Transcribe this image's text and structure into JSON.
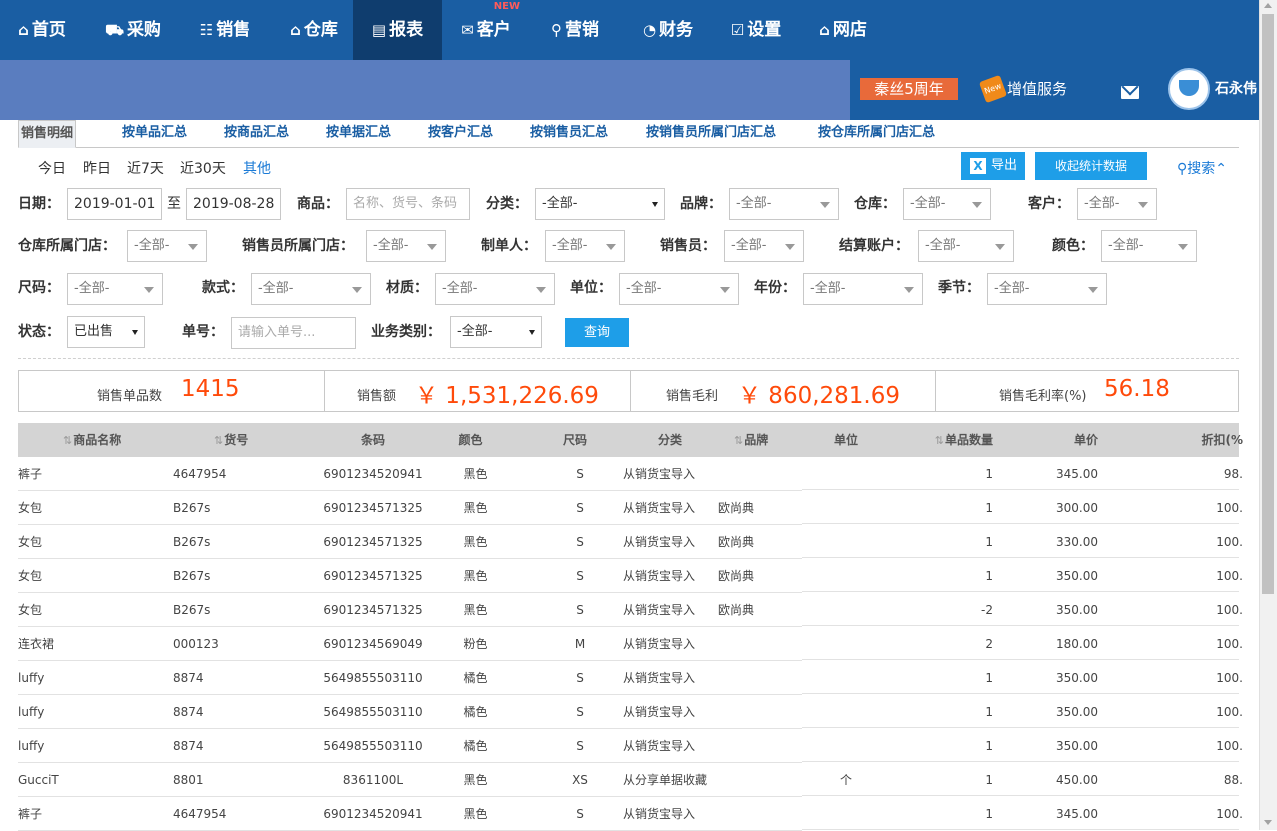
{
  "nav": {
    "items": [
      {
        "label": "首页",
        "icon": "home-icon",
        "glyph": "⌂"
      },
      {
        "label": "采购",
        "icon": "basket-icon",
        "glyph": "⛟"
      },
      {
        "label": "销售",
        "icon": "people-icon",
        "glyph": "☷"
      },
      {
        "label": "仓库",
        "icon": "warehouse-icon",
        "glyph": "⌂"
      },
      {
        "label": "报表",
        "icon": "report-icon",
        "glyph": "▤"
      },
      {
        "label": "客户",
        "icon": "mail-icon",
        "glyph": "✉"
      },
      {
        "label": "营销",
        "icon": "tag-icon",
        "glyph": "⚲"
      },
      {
        "label": "财务",
        "icon": "finance-icon",
        "glyph": "◔"
      },
      {
        "label": "设置",
        "icon": "settings-icon",
        "glyph": "☑"
      },
      {
        "label": "网店",
        "icon": "shop-icon",
        "glyph": "⌂"
      }
    ],
    "active_label": "报表",
    "new_badge": "NEW"
  },
  "banner": {
    "anniversary": "秦丝5周年",
    "value_added_service": "增值服务",
    "value_added_badge": "New",
    "username": "石永伟"
  },
  "tabs": [
    "销售明细",
    "按单品汇总",
    "按商品汇总",
    "按单据汇总",
    "按客户汇总",
    "按销售员汇总",
    "按销售员所属门店汇总",
    "按仓库所属门店汇总"
  ],
  "quick_dates": [
    "今日",
    "昨日",
    "近7天",
    "近30天",
    "其他"
  ],
  "toolbar": {
    "export_label": "导出",
    "collapse_stats_label": "收起统计数据",
    "search_toggle_label": "搜索"
  },
  "filters": {
    "date_label": "日期：",
    "date_from": "2019-01-01",
    "date_to_sep": "至",
    "date_to": "2019-08-28",
    "product_label": "商品：",
    "product_placeholder": "名称、货号、条码",
    "category_label": "分类：",
    "brand_label": "品牌：",
    "warehouse_label": "仓库：",
    "customer_label": "客户：",
    "wh_store_label": "仓库所属门店：",
    "seller_store_label": "销售员所属门店：",
    "creator_label": "制单人：",
    "seller_label": "销售员：",
    "account_label": "结算账户：",
    "color_label": "颜色：",
    "size_label": "尺码：",
    "style_label": "款式：",
    "material_label": "材质：",
    "unit_label": "单位：",
    "year_label": "年份：",
    "season_label": "季节：",
    "status_label": "状态：",
    "status_value": "已出售",
    "order_no_label": "单号：",
    "order_no_placeholder": "请输入单号...",
    "biz_type_label": "业务类别：",
    "all_option": "-全部-",
    "query_button": "查询"
  },
  "summary": [
    {
      "label": "销售单品数",
      "value": "1415"
    },
    {
      "label": "销售额",
      "value": "￥ 1,531,226.69"
    },
    {
      "label": "销售毛利",
      "value": "￥ 860,281.69"
    },
    {
      "label": "销售毛利率(%)",
      "value": "56.18"
    }
  ],
  "table": {
    "columns": [
      "商品名称",
      "货号",
      "条码",
      "颜色",
      "尺码",
      "分类",
      "品牌",
      "单位",
      "单品数量",
      "单价",
      "折扣(%"
    ],
    "rows": [
      [
        "裤子",
        "4647954",
        "6901234520941",
        "黑色",
        "S",
        "从销货宝导入",
        "",
        "",
        "1",
        "345.00",
        "98."
      ],
      [
        "女包",
        "B267s",
        "6901234571325",
        "黑色",
        "S",
        "从销货宝导入",
        "欧尚典",
        "",
        "1",
        "300.00",
        "100."
      ],
      [
        "女包",
        "B267s",
        "6901234571325",
        "黑色",
        "S",
        "从销货宝导入",
        "欧尚典",
        "",
        "1",
        "330.00",
        "100."
      ],
      [
        "女包",
        "B267s",
        "6901234571325",
        "黑色",
        "S",
        "从销货宝导入",
        "欧尚典",
        "",
        "1",
        "350.00",
        "100."
      ],
      [
        "女包",
        "B267s",
        "6901234571325",
        "黑色",
        "S",
        "从销货宝导入",
        "欧尚典",
        "",
        "-2",
        "350.00",
        "100."
      ],
      [
        "连衣裙",
        "000123",
        "6901234569049",
        "粉色",
        "M",
        "从销货宝导入",
        "",
        "",
        "2",
        "180.00",
        "100."
      ],
      [
        "luffy",
        "8874",
        "5649855503110",
        "橘色",
        "S",
        "从销货宝导入",
        "",
        "",
        "1",
        "350.00",
        "100."
      ],
      [
        "luffy",
        "8874",
        "5649855503110",
        "橘色",
        "S",
        "从销货宝导入",
        "",
        "",
        "1",
        "350.00",
        "100."
      ],
      [
        "luffy",
        "8874",
        "5649855503110",
        "橘色",
        "S",
        "从销货宝导入",
        "",
        "",
        "1",
        "350.00",
        "100."
      ],
      [
        "GucciT",
        "8801",
        "8361100L",
        "黑色",
        "XS",
        "从分享单据收藏",
        "",
        "个",
        "1",
        "450.00",
        "88."
      ],
      [
        "裤子",
        "4647954",
        "6901234520941",
        "黑色",
        "S",
        "从销货宝导入",
        "",
        "",
        "1",
        "345.00",
        "100."
      ]
    ]
  },
  "colors": {
    "nav_bg": "#1a5ea3",
    "nav_active": "#0f3d6e",
    "accent_button": "#1e9ee8",
    "summary_value": "#ff4a0a"
  }
}
